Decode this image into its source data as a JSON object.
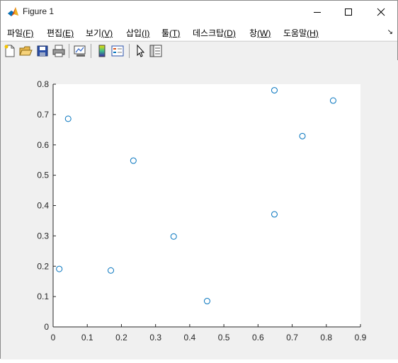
{
  "window": {
    "title": "Figure 1"
  },
  "menu": [
    {
      "label": "파일",
      "accel": "(F)"
    },
    {
      "label": "편집",
      "accel": "(E)"
    },
    {
      "label": "보기",
      "accel": "(V)"
    },
    {
      "label": "삽입",
      "accel": "(I)"
    },
    {
      "label": "툴",
      "accel": "(T)"
    },
    {
      "label": "데스크탑",
      "accel": "(D)"
    },
    {
      "label": "창",
      "accel": "(W)"
    },
    {
      "label": "도움말",
      "accel": "(H)"
    }
  ],
  "toolbar": {
    "icons": [
      "new-figure-icon",
      "open-file-icon",
      "save-icon",
      "print-icon",
      "link-plot-icon",
      "insert-colorbar-icon",
      "insert-legend-icon",
      "edit-plot-pointer-icon",
      "property-inspector-icon"
    ]
  },
  "colors": {
    "marker": "#0072bd",
    "axes_bg": "#ffffff",
    "figure_bg": "#f0f0f0"
  },
  "chart_data": {
    "type": "scatter",
    "title": "",
    "xlabel": "",
    "ylabel": "",
    "xlim": [
      0,
      0.9
    ],
    "ylim": [
      0,
      0.8
    ],
    "xticks": [
      "0",
      "0.1",
      "0.2",
      "0.3",
      "0.4",
      "0.5",
      "0.6",
      "0.7",
      "0.8",
      "0.9"
    ],
    "yticks": [
      "0",
      "0.1",
      "0.2",
      "0.3",
      "0.4",
      "0.5",
      "0.6",
      "0.7",
      "0.8"
    ],
    "grid": false,
    "marker": "circle",
    "points": [
      {
        "x": 0.044,
        "y": 0.686
      },
      {
        "x": 0.018,
        "y": 0.191
      },
      {
        "x": 0.169,
        "y": 0.186
      },
      {
        "x": 0.235,
        "y": 0.548
      },
      {
        "x": 0.353,
        "y": 0.298
      },
      {
        "x": 0.451,
        "y": 0.085
      },
      {
        "x": 0.648,
        "y": 0.78
      },
      {
        "x": 0.648,
        "y": 0.371
      },
      {
        "x": 0.73,
        "y": 0.629
      },
      {
        "x": 0.82,
        "y": 0.746
      }
    ]
  }
}
